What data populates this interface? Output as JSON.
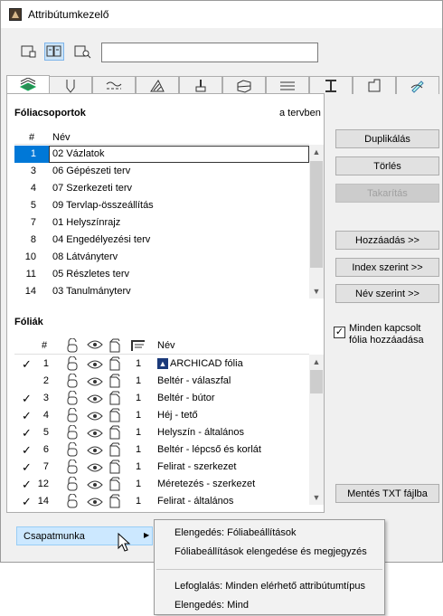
{
  "window": {
    "title": "Attribútumkezelő"
  },
  "toolbar": {
    "modes": [
      "list-view-icon",
      "dual-list-view-icon",
      "search-view-icon"
    ],
    "selected_mode": 1,
    "search_value": ""
  },
  "tabs": [
    "Fóliák",
    "Tollak",
    "Vonaltípusok",
    "Kitöltések",
    "Felületek",
    "Építőanyagok",
    "Szakaszprofilok",
    "Profilok",
    "Zónakategóriák",
    "Grafikus felülírás"
  ],
  "groups": {
    "title": "Fóliacsoportok",
    "subtitle": "a tervben",
    "header": {
      "num": "#",
      "name": "Név"
    },
    "rows": [
      {
        "num": "1",
        "name": "02 Vázlatok"
      },
      {
        "num": "3",
        "name": "06 Gépészeti terv"
      },
      {
        "num": "4",
        "name": "07 Szerkezeti terv"
      },
      {
        "num": "5",
        "name": "09 Tervlap-összeállítás"
      },
      {
        "num": "7",
        "name": "01 Helyszínrajz"
      },
      {
        "num": "8",
        "name": "04 Engedélyezési terv"
      },
      {
        "num": "10",
        "name": "08 Látványterv"
      },
      {
        "num": "11",
        "name": "05 Részletes terv"
      },
      {
        "num": "14",
        "name": "03 Tanulmányterv"
      }
    ]
  },
  "layers": {
    "title": "Fóliák",
    "header": {
      "num": "#",
      "name": "Név"
    },
    "rows": [
      {
        "checked": true,
        "num": "1",
        "pen": "1",
        "name": "ARCHICAD fólia"
      },
      {
        "checked": false,
        "num": "2",
        "pen": "1",
        "name": "Beltér - válaszfal"
      },
      {
        "checked": true,
        "num": "3",
        "pen": "1",
        "name": "Beltér - bútor"
      },
      {
        "checked": true,
        "num": "4",
        "pen": "1",
        "name": "Héj - tető"
      },
      {
        "checked": true,
        "num": "5",
        "pen": "1",
        "name": "Helyszín - általános"
      },
      {
        "checked": true,
        "num": "6",
        "pen": "1",
        "name": "Beltér - lépcső és korlát"
      },
      {
        "checked": true,
        "num": "7",
        "pen": "1",
        "name": "Felirat - szerkezet"
      },
      {
        "checked": true,
        "num": "12",
        "pen": "1",
        "name": "Méretezés - szerkezet"
      },
      {
        "checked": true,
        "num": "14",
        "pen": "1",
        "name": "Felirat - általános"
      }
    ]
  },
  "buttons": {
    "duplicate": "Duplikálás",
    "delete": "Törlés",
    "purge": "Takarítás",
    "add": "Hozzáadás >>",
    "by_index": "Index szerint >>",
    "by_name": "Név szerint >>",
    "save_txt": "Mentés TXT fájlba"
  },
  "add_all_checkbox": {
    "label": "Minden kapcsolt fólia hozzáadása",
    "checked": true
  },
  "teamwork": {
    "label": "Csapatmunka"
  },
  "context_menu": {
    "items": [
      "Elengedés: Fóliabeállítások",
      "Fóliabeállítások elengedése és megjegyzés",
      "Lefoglalás: Minden elérhető attribútumtípus",
      "Elengedés: Mind"
    ]
  },
  "colors": {
    "selection": "#0078d7",
    "selection_light": "#cce8ff",
    "window_bg": "#f0f0f0"
  }
}
